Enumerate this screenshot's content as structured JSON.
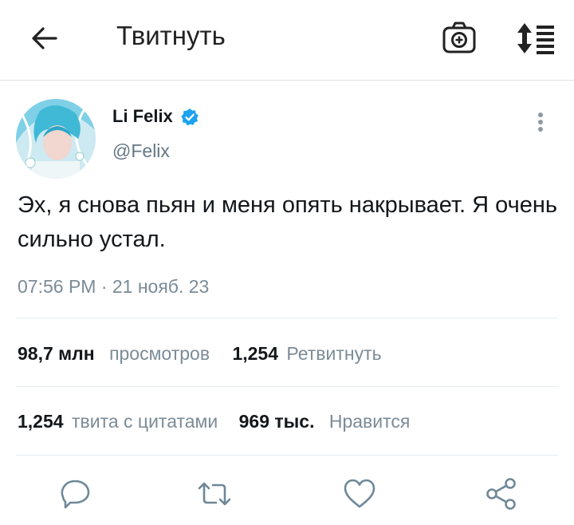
{
  "header": {
    "title": "Твитнуть",
    "back_icon": "arrow-left-icon",
    "camera_icon": "camera-plus-icon",
    "sort_icon": "sort-list-icon"
  },
  "tweet": {
    "author_name": "Li Felix",
    "author_handle": "@Felix",
    "verified": true,
    "text": "Эх, я снова пьян и меня опять накрывает. Я очень сильно устал.",
    "timestamp": "07:56 PM · 21 нояб. 23"
  },
  "stats": {
    "views_count": "98,7 млн",
    "views_label": "просмотров",
    "retweets_count": "1,254",
    "retweets_label": "Ретвитнуть",
    "quotes_count": "1,254",
    "quotes_label": "твита с цитатами",
    "likes_count": "969 тыс.",
    "likes_label": "Нравится"
  },
  "actions": [
    "reply-icon",
    "retweet-icon",
    "like-icon",
    "share-icon"
  ],
  "colors": {
    "accent": "#1da1f2",
    "muted_text": "#7b8b97",
    "icon_gray": "#657786"
  }
}
